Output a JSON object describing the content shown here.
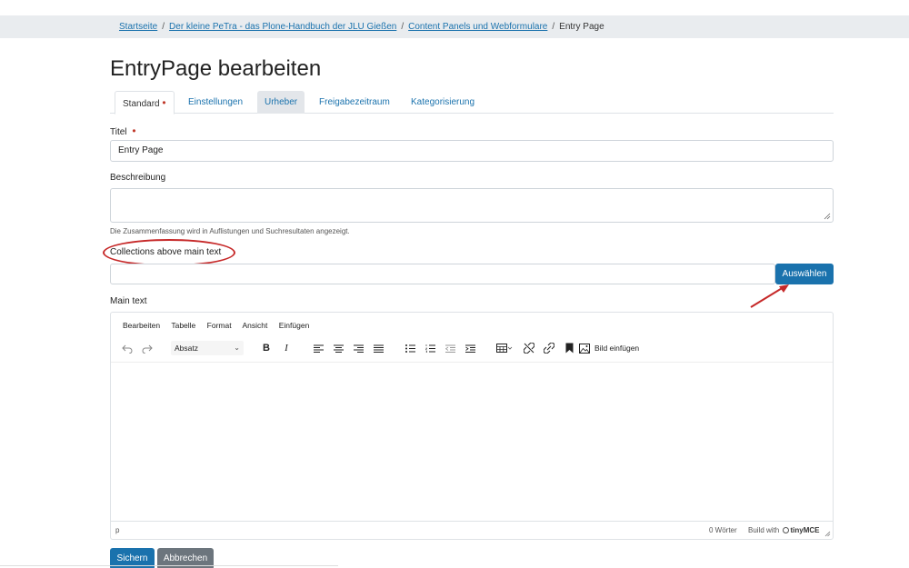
{
  "breadcrumb": {
    "items": [
      "Startseite",
      "Der kleine PeTra - das Plone-Handbuch der JLU Gießen",
      "Content Panels und Webformulare"
    ],
    "current": "Entry Page",
    "separator": "/"
  },
  "page": {
    "title": "EntryPage bearbeiten"
  },
  "tabs": [
    {
      "label": "Standard",
      "required_marker": "•"
    },
    {
      "label": "Einstellungen"
    },
    {
      "label": "Urheber"
    },
    {
      "label": "Freigabezeitraum"
    },
    {
      "label": "Kategorisierung"
    }
  ],
  "form": {
    "title_label": "Titel",
    "title_required_marker": "•",
    "title_value": "Entry Page",
    "description_label": "Beschreibung",
    "description_value": "",
    "description_help": "Die Zusammenfassung wird in Auflistungen und Suchresultaten angezeigt.",
    "collections_label": "Collections above main text",
    "collections_value": "",
    "collections_button": "Auswählen",
    "main_text_label": "Main text"
  },
  "editor": {
    "menu": [
      "Bearbeiten",
      "Tabelle",
      "Format",
      "Ansicht",
      "Einfügen"
    ],
    "blocks_value": "Absatz",
    "toolbar_icons": [
      "undo-icon",
      "redo-icon",
      "bold-icon",
      "italic-icon",
      "align-left-icon",
      "align-center-icon",
      "align-right-icon",
      "align-justify-icon",
      "bullet-list-icon",
      "numbered-list-icon",
      "outdent-icon",
      "indent-icon",
      "table-icon",
      "unlink-icon",
      "link-icon",
      "bookmark-icon",
      "image-icon"
    ],
    "insert_image_label": "Bild einfügen",
    "status_path": "p",
    "word_count": "0 Wörter",
    "build_with": "Build with",
    "brand": "tinyMCE"
  },
  "actions": {
    "save": "Sichern",
    "cancel": "Abbrechen"
  },
  "colors": {
    "link": "#1a72ad",
    "primary": "#1a72ad",
    "secondary": "#6c757d",
    "required": "#c0392b",
    "annotation": "#c62828"
  }
}
